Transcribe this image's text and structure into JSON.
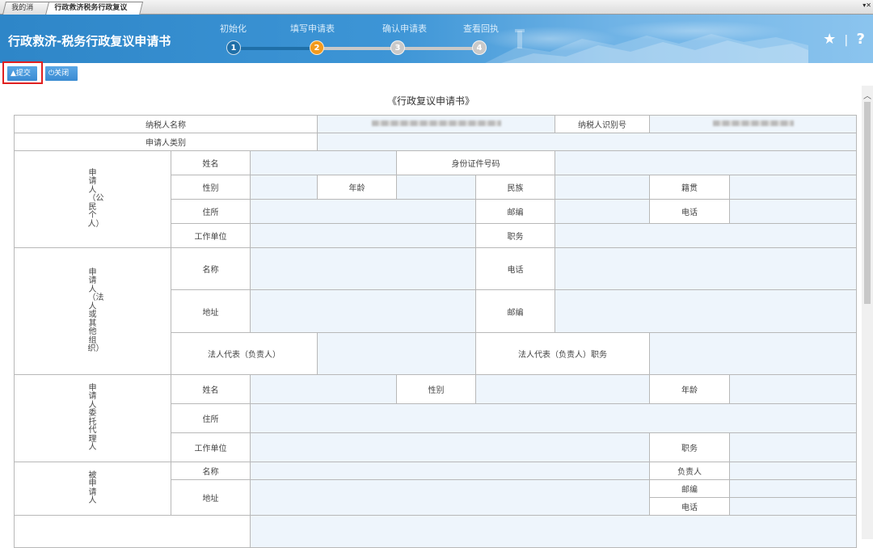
{
  "tabs": [
    {
      "label": "我的消息"
    },
    {
      "label": "行政救济税务行政复议申请书"
    }
  ],
  "banner": {
    "title": "行政救济-税务行政复议申请书",
    "steps": [
      {
        "label": "初始化",
        "num": "1"
      },
      {
        "label": "填写申请表",
        "num": "2"
      },
      {
        "label": "确认申请表",
        "num": "3"
      },
      {
        "label": "查看回执",
        "num": "4"
      }
    ],
    "star_glyph": "★",
    "sep": "|",
    "help_glyph": "?"
  },
  "toolbar": {
    "submit": "提交",
    "close": "关闭"
  },
  "form": {
    "title": "《行政复议申请书》",
    "taxpayer_name": "纳税人名称",
    "taxpayer_id": "纳税人识别号",
    "applicant_type": "申请人类别",
    "group_citizen": "申请人（公民个人）",
    "group_legal": "申请人（法人或其他组织）",
    "group_agent": "申请人委托代理人",
    "group_respondent": "被申请人",
    "name": "姓名",
    "id_no": "身份证件号码",
    "gender": "性别",
    "age": "年龄",
    "ethnicity": "民族",
    "native_place": "籍贯",
    "residence": "住所",
    "postcode": "邮编",
    "phone": "电话",
    "employer": "工作单位",
    "position": "职务",
    "org_name": "名称",
    "address": "地址",
    "legal_rep": "法人代表（负责人）",
    "legal_rep_position": "法人代表（负责人）职务",
    "person_in_charge": "负责人"
  },
  "colors": {
    "step_done": "#1f6fa8",
    "step_active": "#f39a1d",
    "step_pending": "#c9c9c9",
    "field_bg": "#eef5fc",
    "button": "#3a8bd2",
    "highlight": "#e02020"
  }
}
